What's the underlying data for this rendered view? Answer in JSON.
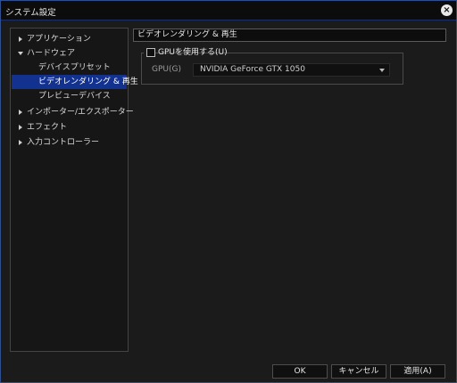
{
  "window": {
    "title": "システム設定"
  },
  "tree": {
    "items": [
      {
        "label": "アプリケーション",
        "state": "collapsed"
      },
      {
        "label": "ハードウェア",
        "state": "expanded"
      },
      {
        "label": "デバイスプリセット",
        "state": "leaf"
      },
      {
        "label": "ビデオレンダリング & 再生",
        "state": "leaf",
        "selected": true
      },
      {
        "label": "プレビューデバイス",
        "state": "leaf"
      },
      {
        "label": "インポーター/エクスポーター",
        "state": "collapsed"
      },
      {
        "label": "エフェクト",
        "state": "collapsed"
      },
      {
        "label": "入力コントローラー",
        "state": "collapsed"
      }
    ]
  },
  "panel": {
    "header": "ビデオレンダリング & 再生",
    "use_gpu": {
      "label": "GPUを使用する(U)",
      "checked": false
    },
    "gpu": {
      "label": "GPU(G)",
      "value": "NVIDIA GeForce GTX 1050"
    }
  },
  "buttons": {
    "ok": "OK",
    "cancel": "キャンセル",
    "apply": "適用(A)"
  },
  "colors": {
    "selection": "#13318f",
    "window_border": "#2f4f8f",
    "background": "#1b1b1b"
  }
}
